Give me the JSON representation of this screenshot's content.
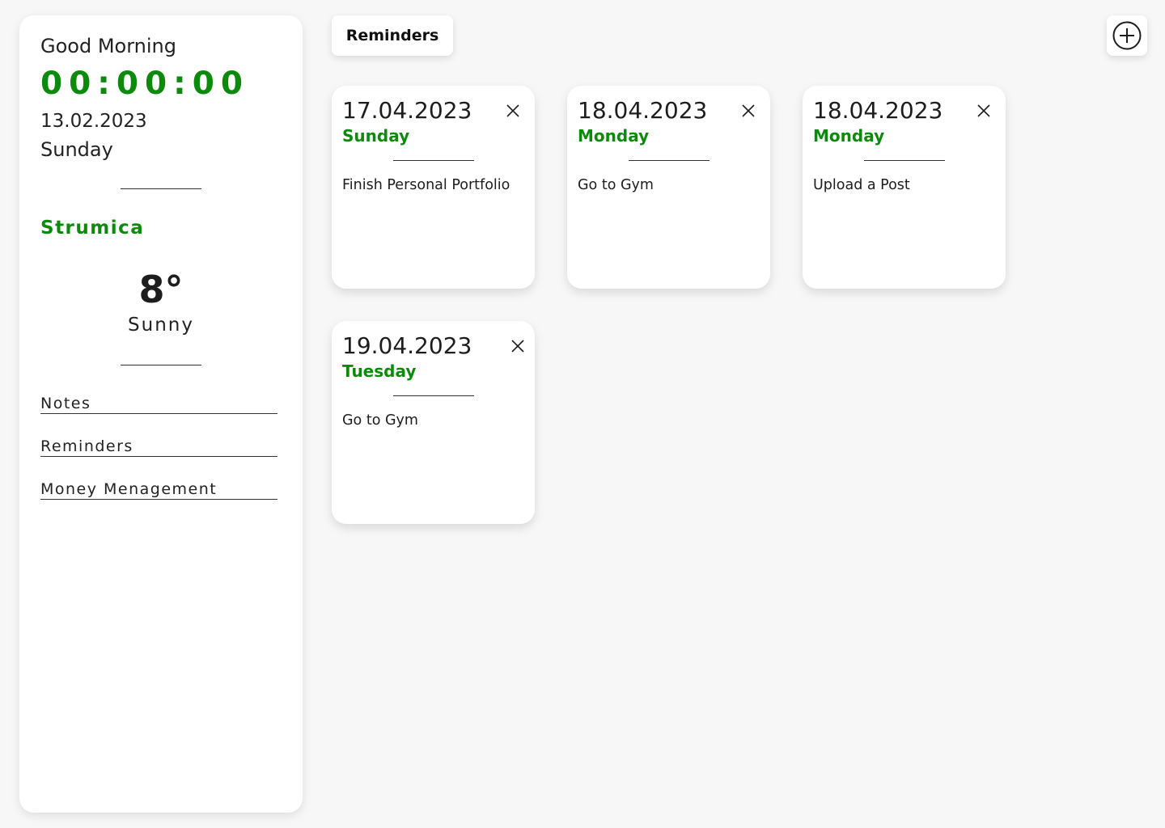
{
  "sidebar": {
    "greeting": "Good Morning",
    "clock": "00:00:00",
    "date": "13.02.2023",
    "day": "Sunday",
    "weather": {
      "city": "Strumica",
      "temperature": "8°",
      "condition": "Sunny"
    },
    "nav": [
      {
        "label": "Notes"
      },
      {
        "label": "Reminders"
      },
      {
        "label": "Money Menagement"
      }
    ]
  },
  "header": {
    "active_tab": "Reminders",
    "add_icon": "plus-circle-icon"
  },
  "reminders": [
    {
      "date": "17.04.2023",
      "day": "Sunday",
      "title": "Finish Personal Portfolio"
    },
    {
      "date": "18.04.2023",
      "day": "Monday",
      "title": "Go to Gym"
    },
    {
      "date": "18.04.2023",
      "day": "Monday",
      "title": "Upload a Post"
    },
    {
      "date": "19.04.2023",
      "day": "Tuesday",
      "title": "Go to Gym"
    }
  ],
  "colors": {
    "accent": "#0c8a0c",
    "background": "#f7f7f7",
    "card": "#ffffff",
    "text": "#1d1d1d"
  }
}
